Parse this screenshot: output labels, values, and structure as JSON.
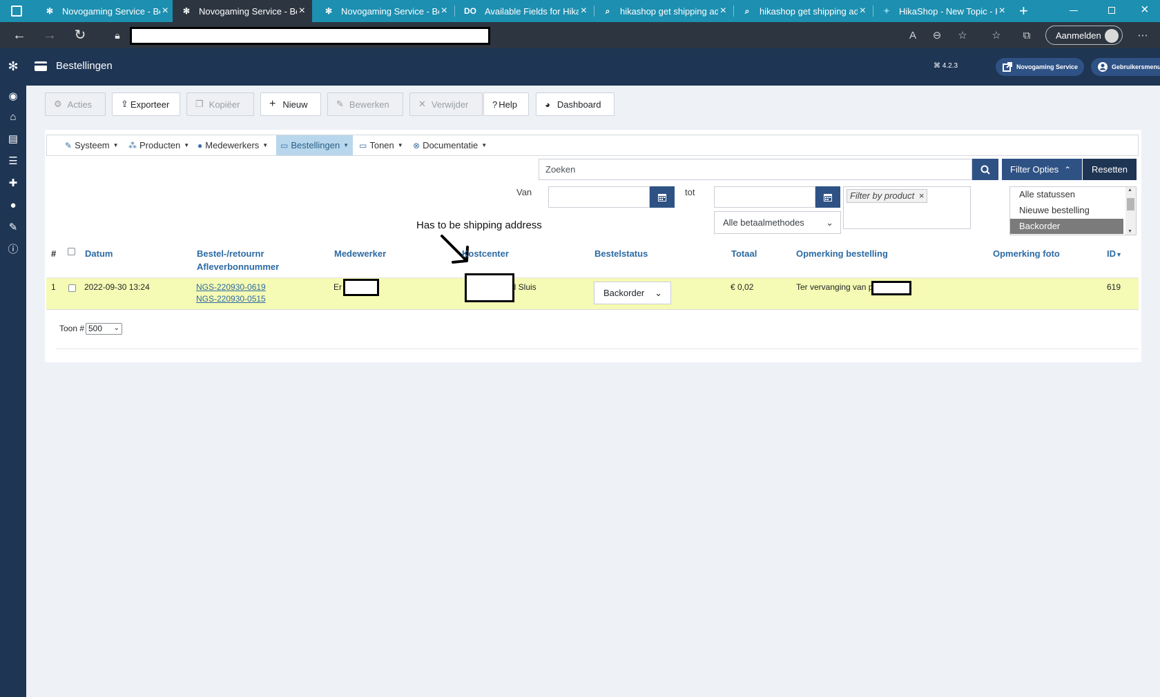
{
  "browser": {
    "tabs": [
      {
        "title": "Novogaming Service - Be",
        "icon": "joomla-icon"
      },
      {
        "title": "Novogaming Service - Be",
        "icon": "joomla-icon"
      },
      {
        "title": "Novogaming Service - Be",
        "icon": "joomla-icon"
      },
      {
        "title": "Available Fields for HikaS",
        "icon": "do-icon"
      },
      {
        "title": "hikashop get shipping ad",
        "icon": "search-icon"
      },
      {
        "title": "hikashop get shipping ad",
        "icon": "search-icon"
      },
      {
        "title": "HikaShop - New Topic - H",
        "icon": "hikashop-icon"
      }
    ],
    "signin_label": "Aanmelden"
  },
  "header": {
    "title": "Bestellingen",
    "version": "4.2.3",
    "site_button": "Novogaming Service",
    "user_menu": "Gebruikersmenu"
  },
  "toolbar": {
    "actions": "Acties",
    "export": "Exporteer",
    "copy": "Kopiëer",
    "new": "Nieuw",
    "edit": "Bewerken",
    "delete": "Verwijder",
    "help": "Help",
    "dashboard": "Dashboard"
  },
  "submenu": [
    {
      "label": "Systeem",
      "icon": "wrench-icon"
    },
    {
      "label": "Producten",
      "icon": "cubes-icon"
    },
    {
      "label": "Medewerkers",
      "icon": "user-icon"
    },
    {
      "label": "Bestellingen",
      "icon": "credit-card-icon"
    },
    {
      "label": "Tonen",
      "icon": "monitor-icon"
    },
    {
      "label": "Documentatie",
      "icon": "help-circle-icon"
    }
  ],
  "filters": {
    "search_placeholder": "Zoeken",
    "filter_options": "Filter Opties",
    "reset": "Resetten",
    "from_label": "Van",
    "to_label": "tot",
    "product_tag": "Filter by product",
    "payment_method": "Alle betaalmethodes",
    "statuses": [
      "Alle statussen",
      "Nieuwe bestelling",
      "Backorder"
    ],
    "selected_status": "Backorder"
  },
  "annotation": "Has to be shipping address",
  "table": {
    "headers": {
      "num": "#",
      "date": "Datum",
      "order_nr": "Bestel-/retournr",
      "delivery_nr": "Afleverbonnummer",
      "employee": "Medewerker",
      "cost_center": "Kostcenter",
      "status": "Bestelstatus",
      "total": "Totaal",
      "order_note": "Opmerking bestelling",
      "photo_note": "Opmerking foto",
      "id": "ID"
    },
    "rows": [
      {
        "num": "1",
        "date": "2022-09-30 13:24",
        "order_nr": "NGS-220930-0619",
        "delivery_nr": "NGS-220930-0515",
        "employee": "Er",
        "cost_center": "al Sluis",
        "status": "Backorder",
        "total": "€ 0,02",
        "order_note": "Ter vervanging van p",
        "photo_note": "",
        "id": "619"
      }
    ]
  },
  "pagination": {
    "show_label": "Toon #",
    "per_page": "500"
  }
}
